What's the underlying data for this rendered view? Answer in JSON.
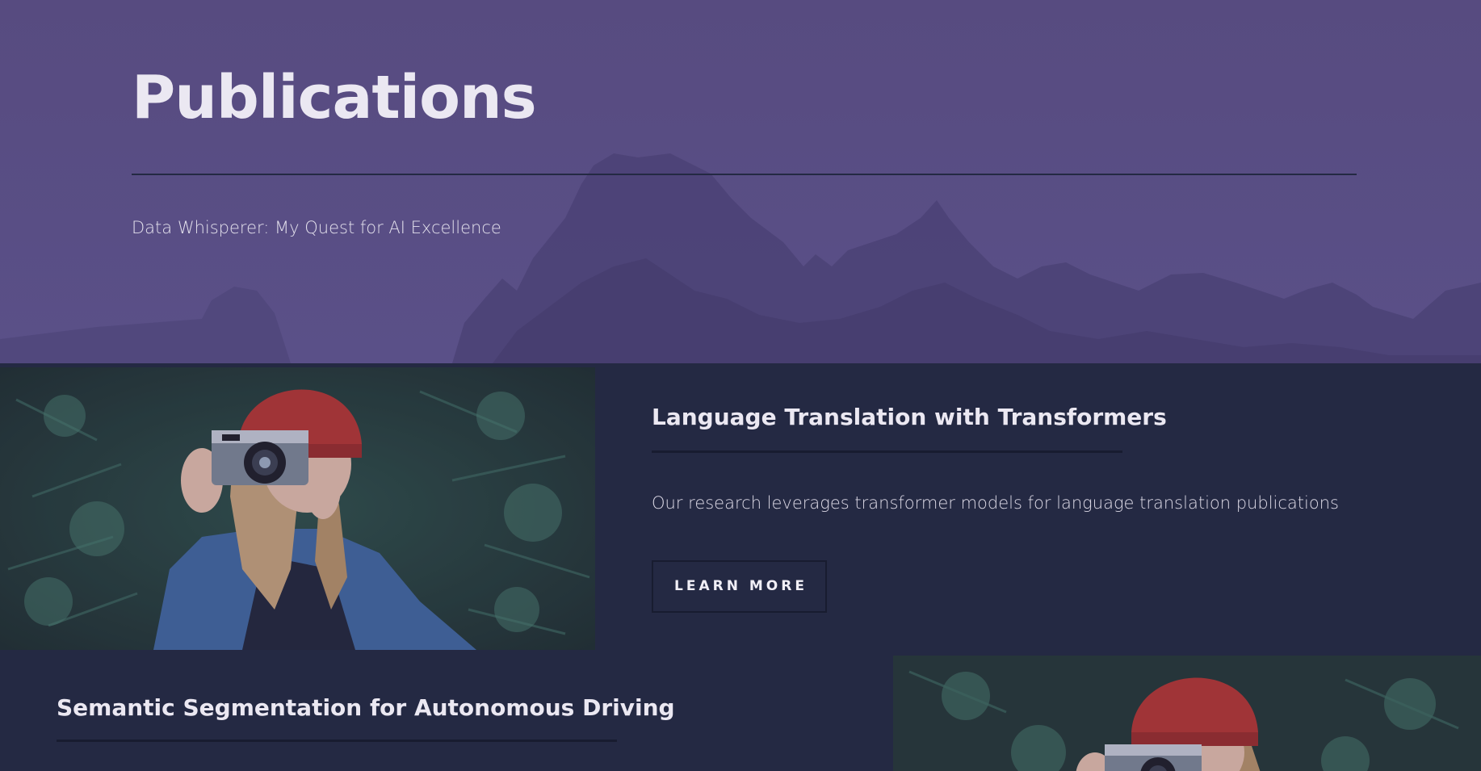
{
  "hero": {
    "title": "Publications",
    "subtitle": "Data Whisperer: My Quest for AI Excellence"
  },
  "spotlights": [
    {
      "title": "Language Translation with Transformers",
      "text": "Our research leverages transformer models for language translation publications",
      "button_label": "LEARN MORE",
      "image": "photographer-with-camera-photo"
    },
    {
      "title": "Semantic Segmentation for Autonomous Driving",
      "image": "photographer-with-camera-photo"
    }
  ],
  "colors": {
    "hero_overlay": "#574d82",
    "page_background": "#242943",
    "text_light": "#ebe8f2",
    "rule": "#181c30"
  }
}
